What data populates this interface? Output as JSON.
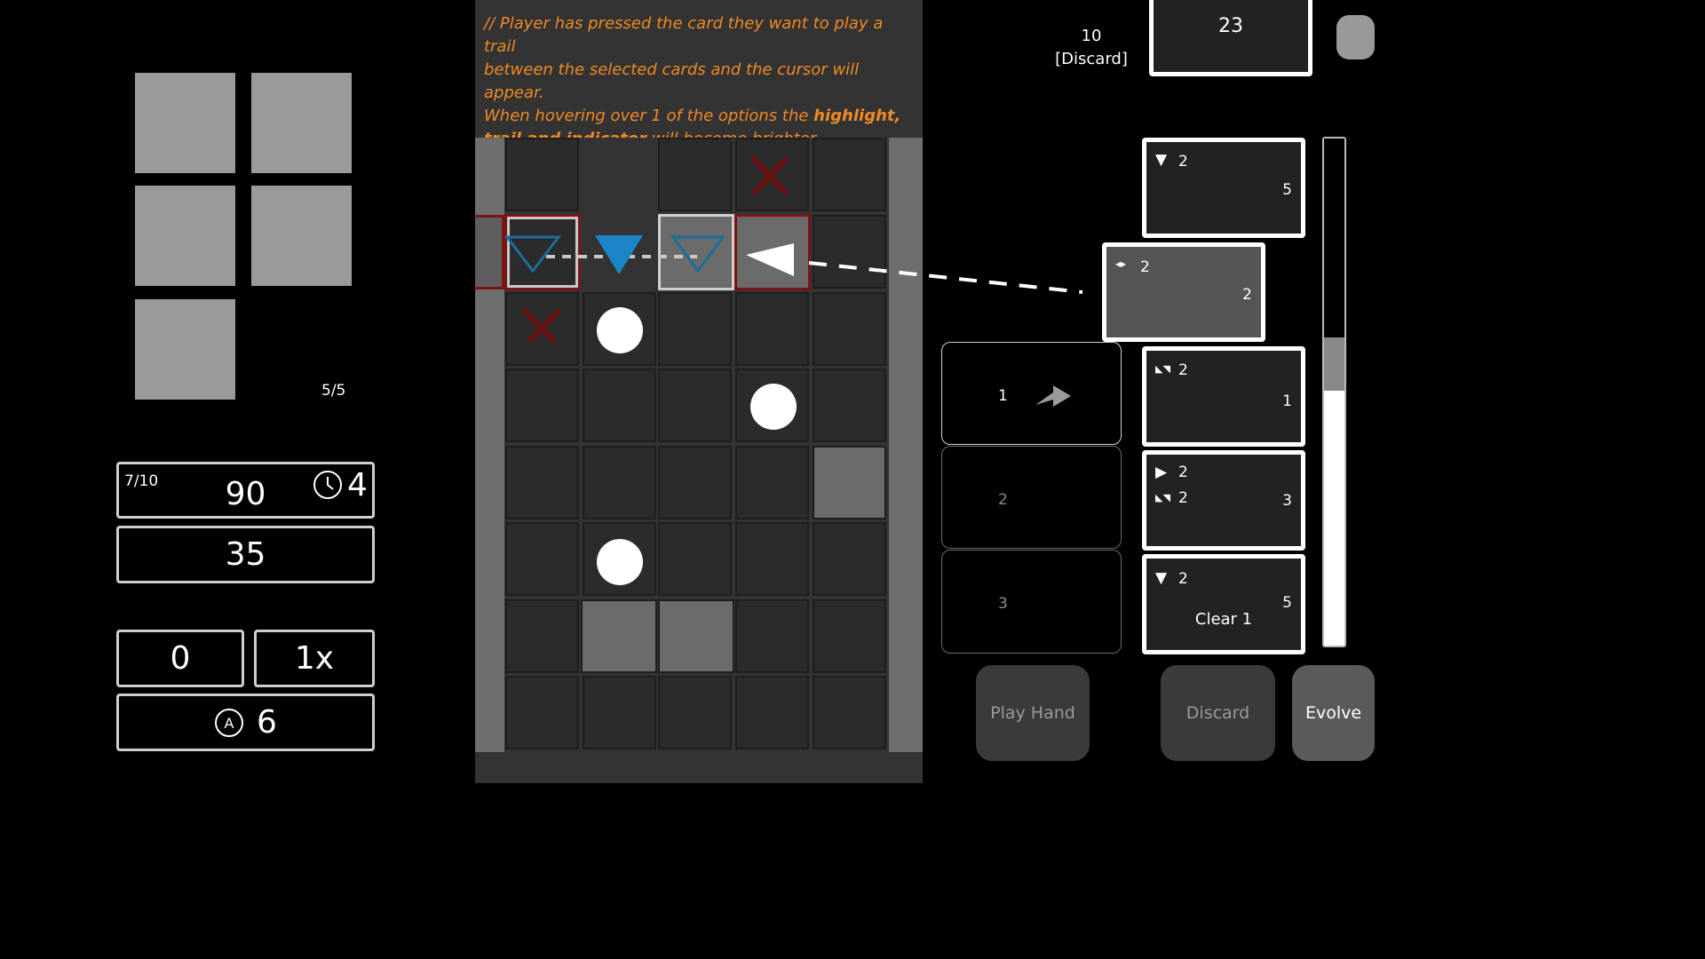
{
  "hand_counter": "5/5",
  "stats": {
    "turns": "7/10",
    "score": "90",
    "timer": "4",
    "target": "35",
    "chips": "0",
    "multiplier": "1x",
    "actions": "6"
  },
  "note": {
    "line1": "// Player has pressed the card they want to play a trail",
    "line2": "between the selected cards and the cursor will appear.",
    "line3_pre": "When hovering over 1 of the options the ",
    "line3_bold": "highlight,",
    "line4_bold": "trail and indicator",
    "line4_post": " will become brighter."
  },
  "deck": {
    "discard_count": "10",
    "discard_label": "[Discard]",
    "remaining": "23"
  },
  "cards": [
    {
      "icon": "down-arrow-icon",
      "value": "2",
      "cost": "5",
      "extra": ""
    },
    {
      "icon": "horizontal-arrows-icon",
      "value": "2",
      "cost": "2",
      "extra": ""
    },
    {
      "icon": "diagonal-arrows-icon",
      "value": "2",
      "cost": "1",
      "extra": ""
    },
    {
      "icon": "right-arrow-icon",
      "value": "2",
      "value2": "2",
      "cost": "3",
      "extra": ""
    },
    {
      "icon": "down-arrow-icon",
      "value": "2",
      "cost": "5",
      "extra": "Clear 1"
    }
  ],
  "options": [
    {
      "label": "1"
    },
    {
      "label": "2"
    },
    {
      "label": "3"
    }
  ],
  "buttons": {
    "play_hand": "Play Hand",
    "discard": "Discard",
    "evolve": "Evolve"
  },
  "colors": {
    "note": "#f08a24",
    "blue": "#1a86c8",
    "red_mark": "#6b1010"
  }
}
